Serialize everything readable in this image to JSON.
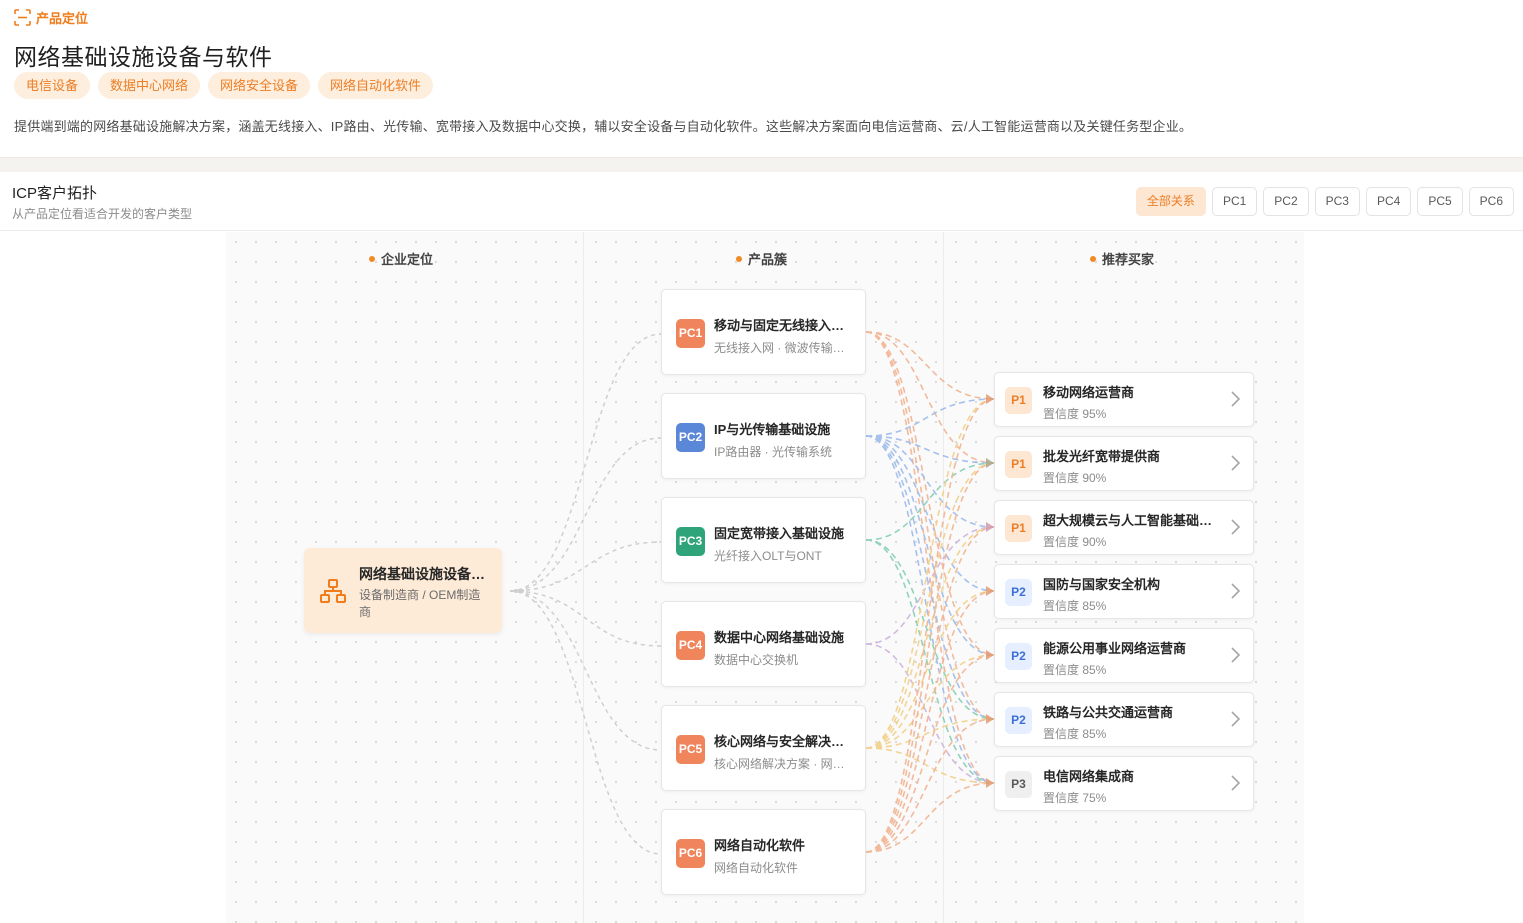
{
  "header": {
    "section_label": "产品定位",
    "product_title": "网络基础设施设备与软件",
    "tags": [
      "电信设备",
      "数据中心网络",
      "网络安全设备",
      "网络自动化软件"
    ],
    "description": "提供端到端的网络基础设施解决方案，涵盖无线接入、IP路由、光传输、宽带接入及数据中心交换，辅以安全设备与自动化软件。这些解决方案面向电信运营商、云/人工智能运营商以及关键任务型企业。"
  },
  "topology": {
    "title": "ICP客户拓扑",
    "subtitle": "从产品定位看适合开发的客户类型",
    "filters": [
      "全部关系",
      "PC1",
      "PC2",
      "PC3",
      "PC4",
      "PC5",
      "PC6"
    ],
    "active_filter": "全部关系",
    "columns": {
      "enterprise": "企业定位",
      "clusters": "产品簇",
      "buyers": "推荐买家"
    },
    "enterprise": {
      "name": "网络基础设施设备与软件",
      "sub": "设备制造商 / OEM制造商",
      "icon": "org-chart-icon"
    },
    "clusters": [
      {
        "code": "PC1",
        "name": "移动与固定无线接入网络",
        "sub": "无线接入网 · 微波传输系统",
        "color": "#f0845a"
      },
      {
        "code": "PC2",
        "name": "IP与光传输基础设施",
        "sub": "IP路由器 · 光传输系统",
        "color": "#5b87d8"
      },
      {
        "code": "PC3",
        "name": "固定宽带接入基础设施",
        "sub": "光纤接入OLT与ONT",
        "color": "#2fa47a"
      },
      {
        "code": "PC4",
        "name": "数据中心网络基础设施",
        "sub": "数据中心交换机",
        "color": "#f0845a"
      },
      {
        "code": "PC5",
        "name": "核心网络与安全解决方案",
        "sub": "核心网络解决方案 · 网络安全设备",
        "color": "#f0845a"
      },
      {
        "code": "PC6",
        "name": "网络自动化软件",
        "sub": "网络自动化软件",
        "color": "#f0845a"
      }
    ],
    "buyers": [
      {
        "priority": "P1",
        "name": "移动网络运营商",
        "confidence": "置信度 95%"
      },
      {
        "priority": "P1",
        "name": "批发光纤宽带提供商",
        "confidence": "置信度 90%"
      },
      {
        "priority": "P1",
        "name": "超大规模云与人工智能基础设施运营商",
        "confidence": "置信度 90%"
      },
      {
        "priority": "P2",
        "name": "国防与国家安全机构",
        "confidence": "置信度 85%"
      },
      {
        "priority": "P2",
        "name": "能源公用事业网络运营商",
        "confidence": "置信度 85%"
      },
      {
        "priority": "P2",
        "name": "铁路与公共交通运营商",
        "confidence": "置信度 85%"
      },
      {
        "priority": "P3",
        "name": "电信网络集成商",
        "confidence": "置信度 75%"
      }
    ]
  }
}
